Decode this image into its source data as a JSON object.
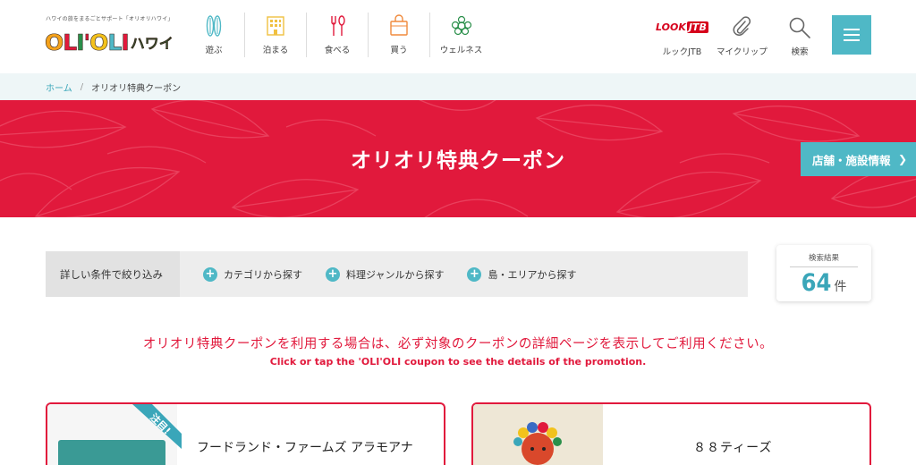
{
  "header": {
    "tagline": "ハワイの旅をまるごとサポート「オリオリハワイ」",
    "logo_text": "OLI'OLI",
    "logo_kana": "ハワイ",
    "nav": [
      {
        "label": "遊ぶ",
        "icon": "surfboard-icon"
      },
      {
        "label": "泊まる",
        "icon": "hotel-icon"
      },
      {
        "label": "食べる",
        "icon": "fork-spoon-icon"
      },
      {
        "label": "買う",
        "icon": "shopping-bag-icon"
      },
      {
        "label": "ウェルネス",
        "icon": "hibiscus-icon"
      }
    ],
    "utility": {
      "lookjtb_logo_look": "LOOK",
      "lookjtb_logo_jtb": "JTB",
      "lookjtb_label": "ルックJTB",
      "myclip_label": "マイクリップ",
      "search_label": "検索"
    }
  },
  "breadcrumb": {
    "home": "ホーム",
    "separator": "/",
    "current": "オリオリ特典クーポン"
  },
  "hero": {
    "title": "オリオリ特典クーポン",
    "store_button": "店舗・施設情報"
  },
  "filter": {
    "label": "詳しい条件で絞り込み",
    "options": [
      "カテゴリから探す",
      "料理ジャンルから探す",
      "島・エリアから探す"
    ]
  },
  "results": {
    "label": "検索結果",
    "count": "64",
    "unit": "件"
  },
  "notice": {
    "jp": "オリオリ特典クーポンを利用する場合は、必ず対象のクーポンの詳細ページを表示してご利用ください。",
    "en": "Click or tap the 'OLI'OLI coupon to see the details of the promotion."
  },
  "cards": [
    {
      "title": "フードランド・ファームズ アラモアナ",
      "ribbon": "注目!"
    },
    {
      "title": "８８ティーズ"
    }
  ],
  "colors": {
    "accent_red": "#e1193c",
    "accent_teal": "#4fb8c6",
    "link_teal": "#3aa6b9"
  }
}
